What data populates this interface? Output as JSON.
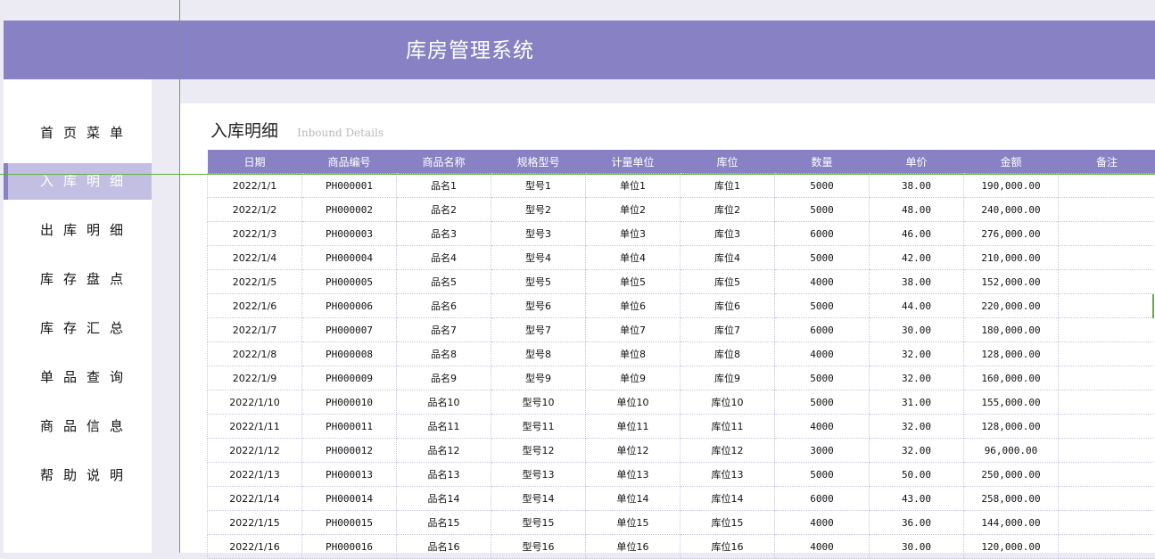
{
  "header": {
    "title": "库房管理系统"
  },
  "sidebar": {
    "active_index": 1,
    "items": [
      {
        "label": "首页菜单",
        "name": "sidebar-item-home-menu"
      },
      {
        "label": "入库明细",
        "name": "sidebar-item-inbound-details"
      },
      {
        "label": "出库明细",
        "name": "sidebar-item-outbound-details"
      },
      {
        "label": "库存盘点",
        "name": "sidebar-item-inventory-count"
      },
      {
        "label": "库存汇总",
        "name": "sidebar-item-inventory-summary"
      },
      {
        "label": "单品查询",
        "name": "sidebar-item-item-query"
      },
      {
        "label": "商品信息",
        "name": "sidebar-item-product-info"
      },
      {
        "label": "帮助说明",
        "name": "sidebar-item-help"
      }
    ]
  },
  "page": {
    "title": "入库明细",
    "subtitle": "Inbound Details"
  },
  "table": {
    "columns": [
      "日期",
      "商品编号",
      "商品名称",
      "规格型号",
      "计量单位",
      "库位",
      "数量",
      "单价",
      "金额",
      "备注"
    ],
    "rows": [
      [
        "2022/1/1",
        "PH000001",
        "品名1",
        "型号1",
        "单位1",
        "库位1",
        "5000",
        "38.00",
        "190,000.00",
        ""
      ],
      [
        "2022/1/2",
        "PH000002",
        "品名2",
        "型号2",
        "单位2",
        "库位2",
        "5000",
        "48.00",
        "240,000.00",
        ""
      ],
      [
        "2022/1/3",
        "PH000003",
        "品名3",
        "型号3",
        "单位3",
        "库位3",
        "6000",
        "46.00",
        "276,000.00",
        ""
      ],
      [
        "2022/1/4",
        "PH000004",
        "品名4",
        "型号4",
        "单位4",
        "库位4",
        "5000",
        "42.00",
        "210,000.00",
        ""
      ],
      [
        "2022/1/5",
        "PH000005",
        "品名5",
        "型号5",
        "单位5",
        "库位5",
        "4000",
        "38.00",
        "152,000.00",
        ""
      ],
      [
        "2022/1/6",
        "PH000006",
        "品名6",
        "型号6",
        "单位6",
        "库位6",
        "5000",
        "44.00",
        "220,000.00",
        ""
      ],
      [
        "2022/1/7",
        "PH000007",
        "品名7",
        "型号7",
        "单位7",
        "库位7",
        "6000",
        "30.00",
        "180,000.00",
        ""
      ],
      [
        "2022/1/8",
        "PH000008",
        "品名8",
        "型号8",
        "单位8",
        "库位8",
        "4000",
        "32.00",
        "128,000.00",
        ""
      ],
      [
        "2022/1/9",
        "PH000009",
        "品名9",
        "型号9",
        "单位9",
        "库位9",
        "5000",
        "32.00",
        "160,000.00",
        ""
      ],
      [
        "2022/1/10",
        "PH000010",
        "品名10",
        "型号10",
        "单位10",
        "库位10",
        "5000",
        "31.00",
        "155,000.00",
        ""
      ],
      [
        "2022/1/11",
        "PH000011",
        "品名11",
        "型号11",
        "单位11",
        "库位11",
        "4000",
        "32.00",
        "128,000.00",
        ""
      ],
      [
        "2022/1/12",
        "PH000012",
        "品名12",
        "型号12",
        "单位12",
        "库位12",
        "3000",
        "32.00",
        "96,000.00",
        ""
      ],
      [
        "2022/1/13",
        "PH000013",
        "品名13",
        "型号13",
        "单位13",
        "库位13",
        "5000",
        "50.00",
        "250,000.00",
        ""
      ],
      [
        "2022/1/14",
        "PH000014",
        "品名14",
        "型号14",
        "单位14",
        "库位14",
        "6000",
        "43.00",
        "258,000.00",
        ""
      ],
      [
        "2022/1/15",
        "PH000015",
        "品名15",
        "型号15",
        "单位15",
        "库位15",
        "4000",
        "36.00",
        "144,000.00",
        ""
      ],
      [
        "2022/1/16",
        "PH000016",
        "品名16",
        "型号16",
        "单位16",
        "库位16",
        "4000",
        "30.00",
        "120,000.00",
        ""
      ]
    ]
  },
  "colors": {
    "accent": "#8882c4",
    "active_nav_bg": "#c3bfe2",
    "page_bg": "#ecebf4",
    "guide_line": "#5fb040"
  }
}
